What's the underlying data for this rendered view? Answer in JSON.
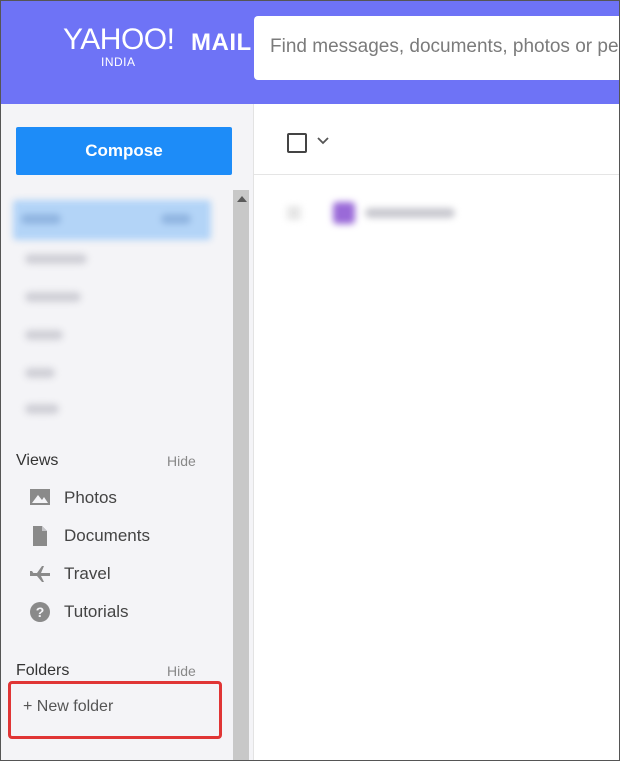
{
  "header": {
    "logo_text": "YAHOO!",
    "logo_mail": "MAIL",
    "logo_sub": "INDIA",
    "search_placeholder": "Find messages, documents, photos or people"
  },
  "sidebar": {
    "compose_label": "Compose",
    "views": {
      "title": "Views",
      "hide_label": "Hide",
      "items": [
        {
          "label": "Photos",
          "icon": "photo-icon"
        },
        {
          "label": "Documents",
          "icon": "document-icon"
        },
        {
          "label": "Travel",
          "icon": "airplane-icon"
        },
        {
          "label": "Tutorials",
          "icon": "help-icon"
        }
      ]
    },
    "folders": {
      "title": "Folders",
      "hide_label": "Hide",
      "new_folder_label": "+ New folder"
    }
  },
  "colors": {
    "header_bg": "#6e73f6",
    "compose_bg": "#1d8cf8",
    "highlight_border": "#e03535"
  }
}
